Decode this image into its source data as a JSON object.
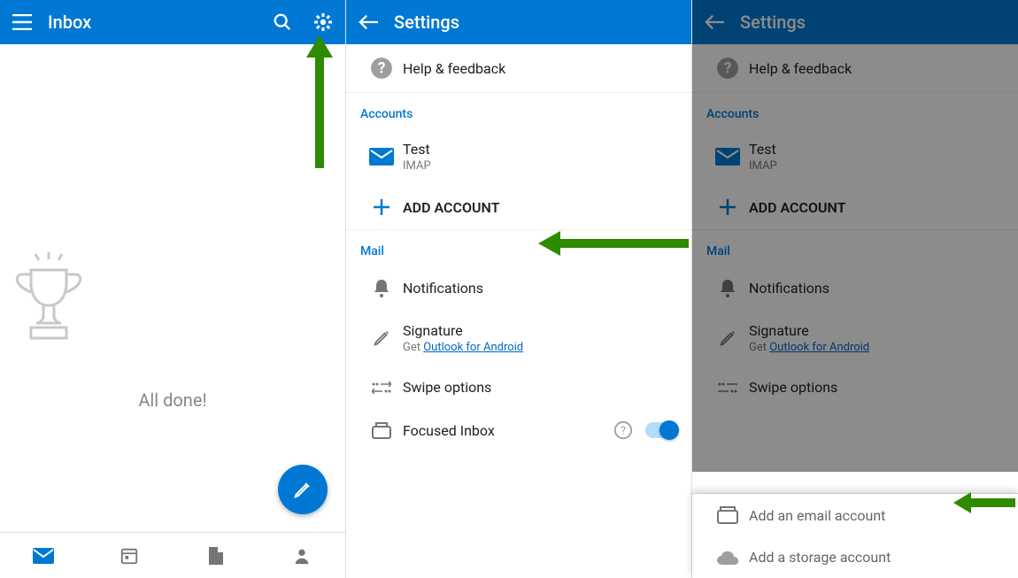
{
  "panel1": {
    "title": "Inbox",
    "all_done": "All done!"
  },
  "panel2": {
    "title": "Settings",
    "help": "Help & feedback",
    "section_accounts": "Accounts",
    "account_name": "Test",
    "account_type": "IMAP",
    "add_account": "ADD ACCOUNT",
    "section_mail": "Mail",
    "notifications": "Notifications",
    "signature": "Signature",
    "signature_get": "Get ",
    "signature_link": "Outlook for Android",
    "swipe": "Swipe options",
    "focused": "Focused Inbox"
  },
  "panel3": {
    "title": "Settings",
    "help": "Help & feedback",
    "section_accounts": "Accounts",
    "account_name": "Test",
    "account_type": "IMAP",
    "add_account": "ADD ACCOUNT",
    "section_mail": "Mail",
    "notifications": "Notifications",
    "signature": "Signature",
    "signature_get": "Get ",
    "signature_link": "Outlook for Android",
    "swipe": "Swipe options",
    "sheet_email": "Add an email account",
    "sheet_storage": "Add a storage account"
  }
}
